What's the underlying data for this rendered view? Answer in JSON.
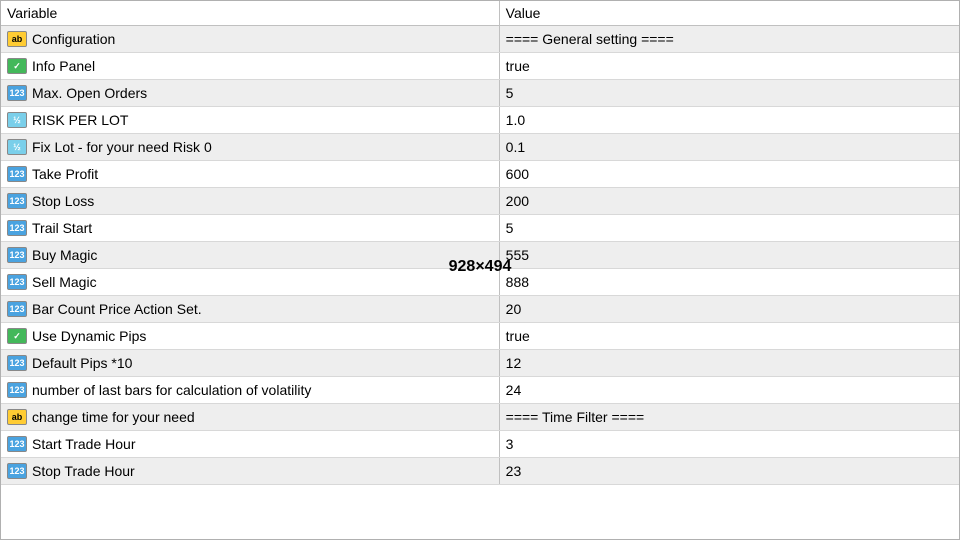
{
  "headers": {
    "variable": "Variable",
    "value": "Value"
  },
  "watermark": "928×494",
  "icon_labels": {
    "string": "ab",
    "bool": "✓",
    "int": "123",
    "double": "½"
  },
  "rows": [
    {
      "type": "string",
      "variable": "Configuration",
      "value": "==== General setting ====",
      "alt": true
    },
    {
      "type": "bool",
      "variable": "Info Panel",
      "value": "true",
      "alt": false
    },
    {
      "type": "int",
      "variable": "Max. Open Orders",
      "value": "5",
      "alt": true
    },
    {
      "type": "double",
      "variable": "RISK PER LOT",
      "value": "1.0",
      "alt": false
    },
    {
      "type": "double",
      "variable": "Fix Lot - for your need Risk 0",
      "value": "0.1",
      "alt": true
    },
    {
      "type": "int",
      "variable": "Take Profit",
      "value": "600",
      "alt": false
    },
    {
      "type": "int",
      "variable": "Stop Loss",
      "value": "200",
      "alt": true
    },
    {
      "type": "int",
      "variable": "Trail Start",
      "value": "5",
      "alt": false
    },
    {
      "type": "int",
      "variable": "Buy Magic",
      "value": "555",
      "alt": true
    },
    {
      "type": "int",
      "variable": "Sell Magic",
      "value": "888",
      "alt": false
    },
    {
      "type": "int",
      "variable": "Bar Count Price Action Set.",
      "value": "20",
      "alt": true
    },
    {
      "type": "bool",
      "variable": "Use Dynamic Pips",
      "value": "true",
      "alt": false
    },
    {
      "type": "int",
      "variable": "Default Pips *10",
      "value": "12",
      "alt": true
    },
    {
      "type": "int",
      "variable": "number of last bars for calculation of volatility",
      "value": "24",
      "alt": false
    },
    {
      "type": "string",
      "variable": "change time for your need",
      "value": "==== Time Filter ====",
      "alt": true
    },
    {
      "type": "int",
      "variable": "Start Trade Hour",
      "value": "3",
      "alt": false
    },
    {
      "type": "int",
      "variable": "Stop Trade Hour",
      "value": "23",
      "alt": true
    }
  ]
}
